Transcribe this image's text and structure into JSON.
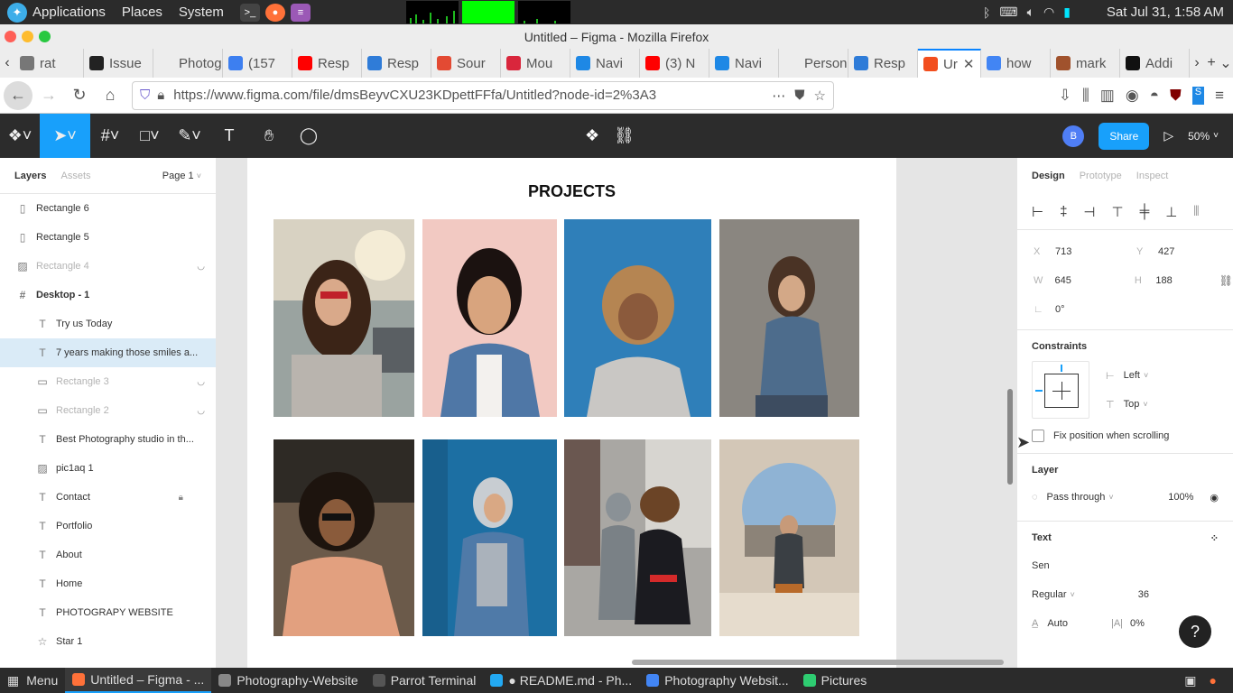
{
  "os_panel": {
    "menus": [
      "Applications",
      "Places",
      "System"
    ],
    "datetime": "Sat Jul 31,  1:58 AM"
  },
  "window": {
    "title": "Untitled – Figma - Mozilla Firefox"
  },
  "tabs": [
    {
      "label": "rat",
      "color": "#777777"
    },
    {
      "label": "Issue",
      "color": "#222222"
    },
    {
      "label": "Photogr",
      "color": "#ededed"
    },
    {
      "label": "(157",
      "color": "#3d7ff0"
    },
    {
      "label": "Resp",
      "color": "#ff0000"
    },
    {
      "label": "Resp",
      "color": "#2f7cd8"
    },
    {
      "label": "Sour",
      "color": "#e34a33"
    },
    {
      "label": "Mou",
      "color": "#d9263c"
    },
    {
      "label": "Navi",
      "color": "#1e88e5"
    },
    {
      "label": "(3) N",
      "color": "#ff0000"
    },
    {
      "label": "Navi",
      "color": "#1e88e5"
    },
    {
      "label": "Persona",
      "color": "#ededed"
    },
    {
      "label": "Resp",
      "color": "#2f7cd8"
    },
    {
      "label": "Ur",
      "color": "#f24e1e",
      "active": true
    },
    {
      "label": "how",
      "color": "#4285f4"
    },
    {
      "label": "mark",
      "color": "#a0522d"
    },
    {
      "label": "Addi",
      "color": "#111111"
    }
  ],
  "url": "https://www.figma.com/file/dmsBeyvCXU23KDpettFFfa/Untitled?node-id=2%3A3",
  "figma": {
    "share_label": "Share",
    "avatar_letter": "B",
    "zoom": "50%"
  },
  "layers_panel": {
    "tab_layers": "Layers",
    "tab_assets": "Assets",
    "page": "Page 1",
    "items": [
      {
        "label": "Rectangle 6",
        "icon": "rectangle-icon",
        "glyph": "▯",
        "dim": false,
        "child": false
      },
      {
        "label": "Rectangle 5",
        "icon": "rectangle-icon",
        "glyph": "▯",
        "dim": false,
        "child": false
      },
      {
        "label": "Rectangle 4",
        "icon": "image-icon",
        "glyph": "▨",
        "dim": true,
        "child": false,
        "hidden": true
      },
      {
        "label": "Desktop - 1",
        "icon": "frame-icon",
        "glyph": "#",
        "dim": false,
        "child": false,
        "frame": true
      },
      {
        "label": "Try us Today",
        "icon": "text-icon",
        "glyph": "T",
        "dim": false,
        "child": true
      },
      {
        "label": "7 years making those smiles a...",
        "icon": "text-icon",
        "glyph": "T",
        "dim": false,
        "child": true,
        "selected": true
      },
      {
        "label": "Rectangle 3",
        "icon": "rectangle-icon",
        "glyph": "▭",
        "dim": true,
        "child": true,
        "hidden": true
      },
      {
        "label": "Rectangle 2",
        "icon": "rectangle-icon",
        "glyph": "▭",
        "dim": true,
        "child": true,
        "hidden": true
      },
      {
        "label": "Best Photography studio in th...",
        "icon": "text-icon",
        "glyph": "T",
        "dim": false,
        "child": true
      },
      {
        "label": "pic1aq 1",
        "icon": "image-icon",
        "glyph": "▨",
        "dim": false,
        "child": true
      },
      {
        "label": "Contact",
        "icon": "text-icon",
        "glyph": "T",
        "dim": false,
        "child": true,
        "locked": true
      },
      {
        "label": "Portfolio",
        "icon": "text-icon",
        "glyph": "T",
        "dim": false,
        "child": true
      },
      {
        "label": "About",
        "icon": "text-icon",
        "glyph": "T",
        "dim": false,
        "child": true
      },
      {
        "label": "Home",
        "icon": "text-icon",
        "glyph": "T",
        "dim": false,
        "child": true
      },
      {
        "label": "PHOTOGRAPY WEBSITE",
        "icon": "text-icon",
        "glyph": "T",
        "dim": false,
        "child": true
      },
      {
        "label": "Star 1",
        "icon": "star-icon",
        "glyph": "☆",
        "dim": false,
        "child": true
      }
    ]
  },
  "canvas": {
    "heading": "PROJECTS"
  },
  "properties": {
    "tab_design": "Design",
    "tab_prototype": "Prototype",
    "tab_inspect": "Inspect",
    "x_label": "X",
    "x": "713",
    "y_label": "Y",
    "y": "427",
    "w_label": "W",
    "w": "645",
    "h_label": "H",
    "h": "188",
    "rotation": "0°",
    "constraints_title": "Constraints",
    "constraint_h": "Left",
    "constraint_v": "Top",
    "fix_position": "Fix position when scrolling",
    "layer_title": "Layer",
    "blend": "Pass through",
    "opacity": "100%",
    "text_title": "Text",
    "font": "Sen",
    "weight": "Regular",
    "size": "36",
    "line_height": "Auto",
    "letter_spacing": "0%"
  },
  "taskbar": {
    "menu": "Menu",
    "items": [
      {
        "label": "Untitled – Figma - ...",
        "color": "#ff7139",
        "active": true
      },
      {
        "label": "Photography-Website",
        "color": "#888888"
      },
      {
        "label": "Parrot Terminal",
        "color": "#555555"
      },
      {
        "label": "● README.md - Ph...",
        "color": "#23a9f2"
      },
      {
        "label": "Photography Websit...",
        "color": "#4285f4"
      },
      {
        "label": "Pictures",
        "color": "#2ecc71"
      }
    ]
  },
  "colors": {
    "figma_blue": "#18a0fb",
    "toolbar_bg": "#2c2c2c",
    "selection_bg": "#daebf7"
  }
}
